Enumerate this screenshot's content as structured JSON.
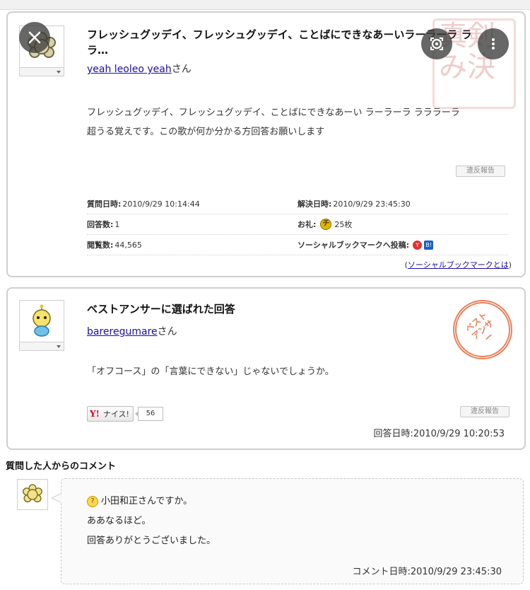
{
  "question": {
    "title": "フレッシュグッデイ、フレッシュグッデイ、ことばにできなあーいラーラーラ ララ…",
    "user": "yeah leoleo yeah",
    "user_suffix": "さん",
    "body_line1": "フレッシュグッデイ、フレッシュグッデイ、ことばにできなあーい ラーラーラ ラララーラ",
    "body_line2": "超うる覚えです。この歌が何か分かる方回答お願いします",
    "report_label": "違反報告",
    "info": {
      "asked_label": "質問日時:",
      "asked_value": "2010/9/29 10:14:44",
      "resolved_label": "解決日時:",
      "resolved_value": "2010/9/29 23:45:30",
      "answers_label": "回答数:",
      "answers_value": "1",
      "reward_label": "お礼:",
      "reward_value": "25枚",
      "views_label": "閲覧数:",
      "views_value": "44,565",
      "social_label": "ソーシャルブックマークへ投稿:"
    },
    "social_link_open": "(",
    "social_link": "ソーシャルブックマークとは",
    "social_link_close": ")",
    "stamp_text": "真剣み決"
  },
  "best_answer": {
    "heading": "ベストアンサーに選ばれた回答",
    "user": "bareregumare",
    "user_suffix": "さん",
    "body": "「オフコース」の「言葉にできない」じゃないでしょうか。",
    "nice_label": "ナイス!",
    "nice_brand": "Y!",
    "nice_count": "56",
    "report_label": "違反報告",
    "answered_at": "回答日時:2010/9/29 10:20:53",
    "stamp_text": "ベスト アンサー"
  },
  "comment": {
    "heading": "質問した人からのコメント",
    "line1": "小田和正さんですか。",
    "line2": "ああなるほど。",
    "line3": "回答ありがとうございました。",
    "date": "コメント日時:2010/9/29 23:45:30"
  },
  "overlay": {
    "close_icon": "close-icon",
    "lens_icon": "lens-icon"
  }
}
